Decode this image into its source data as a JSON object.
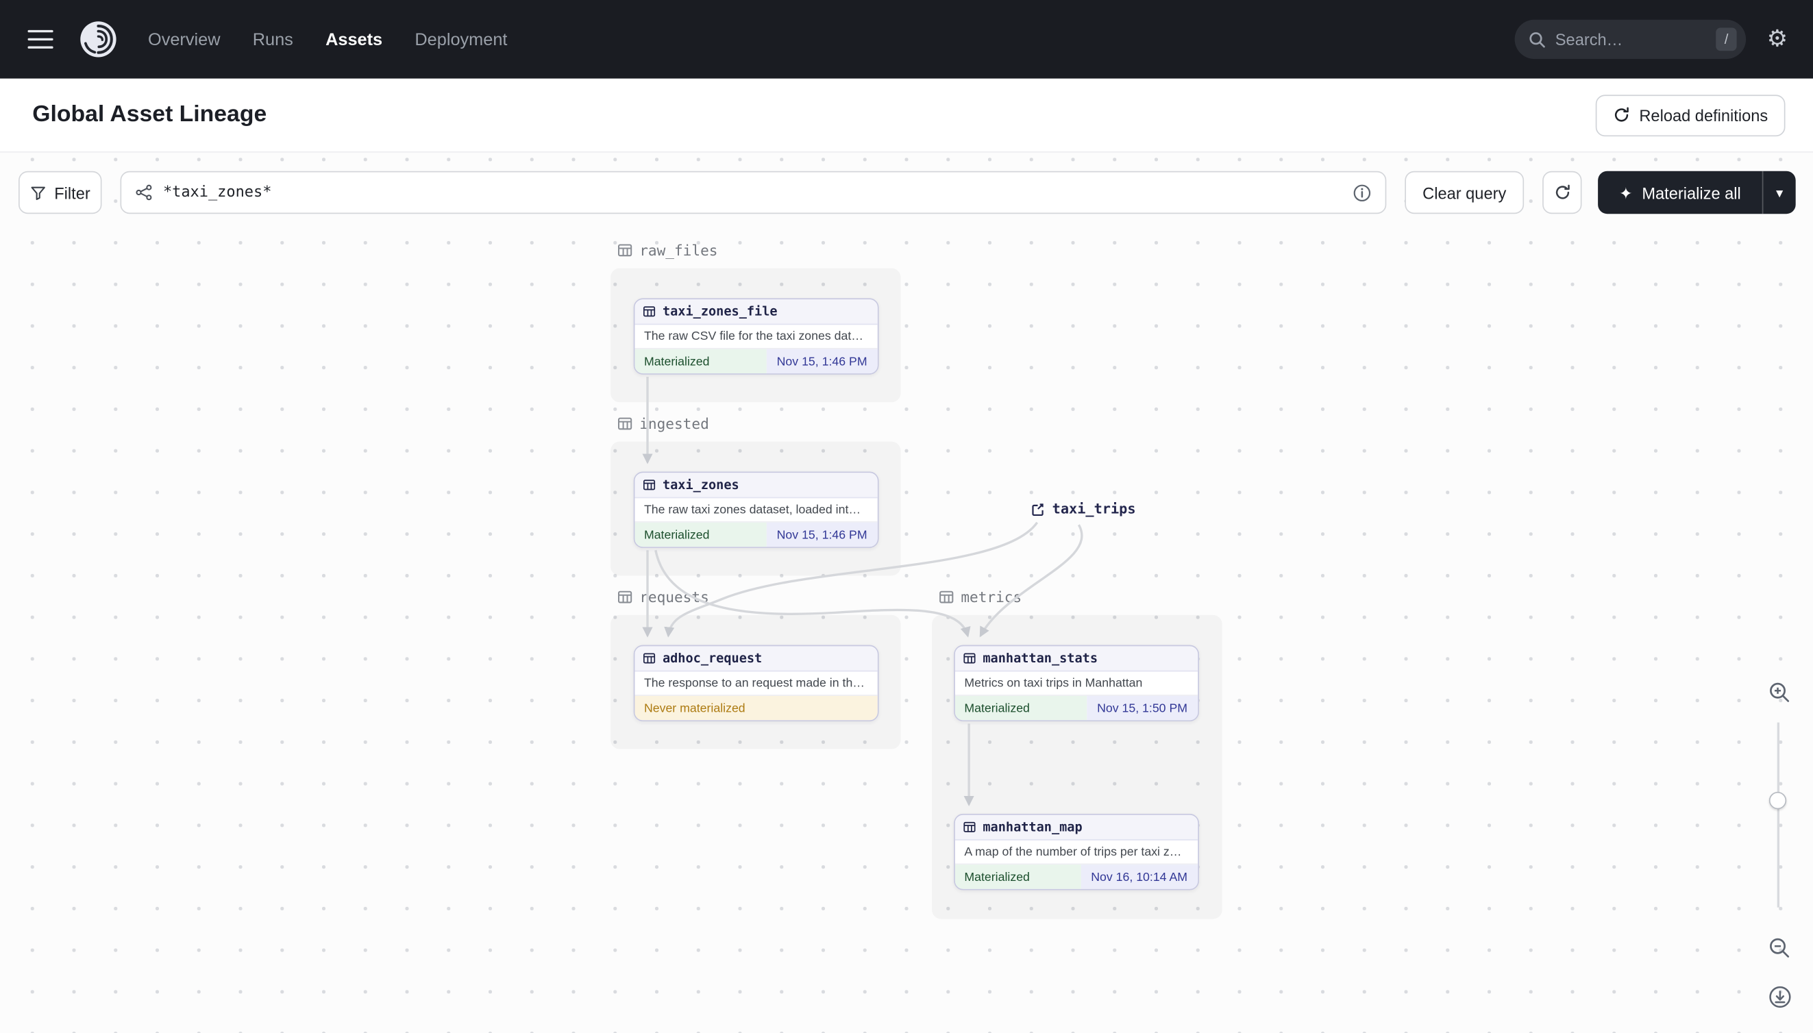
{
  "colors": {
    "navbar_bg": "#1a1c22",
    "accent_dark": "#1e222a",
    "materialized_text": "#1c4f2d",
    "materialized_bg": "#e9f5ec",
    "timestamp_text": "#323896",
    "timestamp_bg": "#ecedfa",
    "never_materialized_text": "#ad7b12",
    "never_materialized_bg": "#fbf3df",
    "node_border": "#c7c8e0",
    "edge": "#d5d7db"
  },
  "icons": {
    "gear": "⚙",
    "sparkle": "✦",
    "chevron_down": "▾"
  },
  "navbar": {
    "items": [
      {
        "label": "Overview"
      },
      {
        "label": "Runs"
      },
      {
        "label": "Assets"
      },
      {
        "label": "Deployment"
      }
    ],
    "search_placeholder": "Search…",
    "search_shortcut": "/"
  },
  "header": {
    "title": "Global Asset Lineage",
    "reload_button_label": "Reload definitions"
  },
  "toolbar": {
    "filter_label": "Filter",
    "query_value": "*taxi_zones*",
    "clear_query_label": "Clear query",
    "materialize_label": "Materialize all"
  },
  "graph": {
    "groups": [
      {
        "name": "raw_files"
      },
      {
        "name": "ingested"
      },
      {
        "name": "requests"
      },
      {
        "name": "metrics"
      }
    ],
    "external_assets": [
      {
        "name": "taxi_trips"
      }
    ],
    "nodes": [
      {
        "name": "taxi_zones_file",
        "description": "The raw CSV file for the taxi zones dat…",
        "status": "Materialized",
        "timestamp": "Nov 15, 1:46 PM"
      },
      {
        "name": "taxi_zones",
        "description": "The raw taxi zones dataset, loaded int…",
        "status": "Materialized",
        "timestamp": "Nov 15, 1:46 PM"
      },
      {
        "name": "adhoc_request",
        "description": "The response to an request made in th…",
        "status": "Never materialized",
        "timestamp": ""
      },
      {
        "name": "manhattan_stats",
        "description": "Metrics on taxi trips in Manhattan",
        "status": "Materialized",
        "timestamp": "Nov 15, 1:50 PM"
      },
      {
        "name": "manhattan_map",
        "description": "A map of the number of trips per taxi z…",
        "status": "Materialized",
        "timestamp": "Nov 16, 10:14 AM"
      }
    ],
    "edges": [
      {
        "from": "taxi_zones_file",
        "to": "taxi_zones"
      },
      {
        "from": "taxi_zones",
        "to": "adhoc_request"
      },
      {
        "from": "taxi_zones",
        "to": "manhattan_stats"
      },
      {
        "from": "taxi_trips",
        "to": "adhoc_request"
      },
      {
        "from": "taxi_trips",
        "to": "manhattan_stats"
      },
      {
        "from": "manhattan_stats",
        "to": "manhattan_map"
      }
    ]
  }
}
